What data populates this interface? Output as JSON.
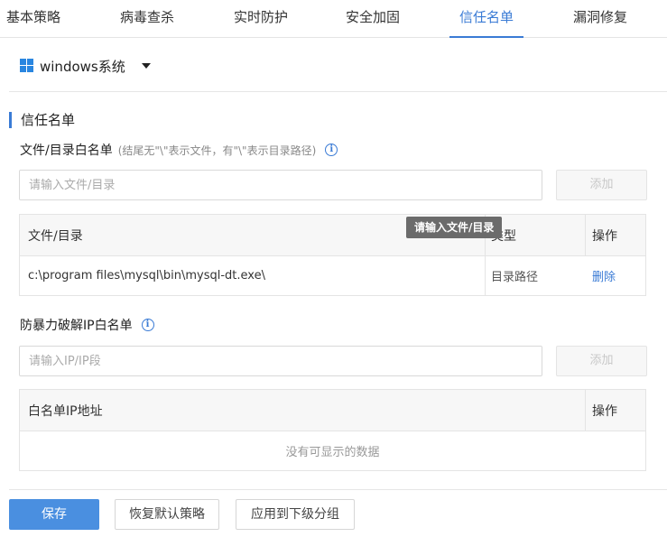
{
  "tabs": [
    {
      "label": "基本策略",
      "active": false
    },
    {
      "label": "病毒查杀",
      "active": false
    },
    {
      "label": "实时防护",
      "active": false
    },
    {
      "label": "安全加固",
      "active": false
    },
    {
      "label": "信任名单",
      "active": true
    },
    {
      "label": "漏洞修复",
      "active": false
    }
  ],
  "os_select": {
    "label": "windows系统",
    "icon": "windows-icon"
  },
  "section_title": "信任名单",
  "file_whitelist": {
    "title": "文件/目录白名单",
    "hint": "(结尾无\"\\\"表示文件，有\"\\\"表示目录路径)",
    "info_icon": "info-icon",
    "input_placeholder": "请输入文件/目录",
    "add_label": "添加",
    "table": {
      "columns": [
        "文件/目录",
        "类型",
        "操作"
      ],
      "rows": [
        {
          "path": "c:\\program files\\mysql\\bin\\mysql-dt.exe\\",
          "type": "目录路径",
          "action": "删除"
        }
      ]
    }
  },
  "tooltip": "请输入文件/目录",
  "ip_whitelist": {
    "title": "防暴力破解IP白名单",
    "info_icon": "info-icon",
    "input_placeholder": "请输入IP/IP段",
    "add_label": "添加",
    "table": {
      "columns": [
        "白名单IP地址",
        "操作"
      ],
      "empty_text": "没有可显示的数据"
    }
  },
  "footer": {
    "save_label": "保存",
    "restore_label": "恢复默认策略",
    "apply_label": "应用到下级分组"
  },
  "colors": {
    "accent": "#3a7bd5",
    "primary_button": "#4a8fe0",
    "windows_blue": "#2a86e0"
  }
}
